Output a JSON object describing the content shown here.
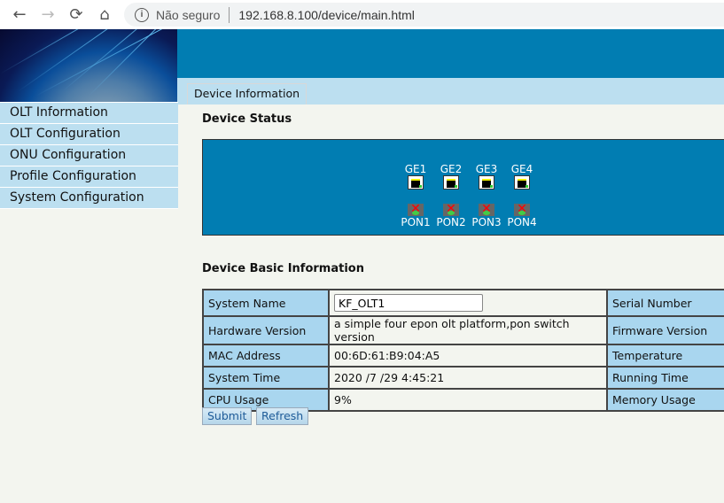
{
  "browser": {
    "back": "←",
    "forward": "→",
    "reload": "⟳",
    "home": "⌂",
    "security": "Não seguro",
    "url": "192.168.8.100/device/main.html"
  },
  "tab": "Device Information",
  "sidebar": [
    "OLT Information",
    "OLT Configuration",
    "ONU Configuration",
    "Profile Configuration",
    "System Configuration"
  ],
  "status": {
    "title": "Device Status",
    "ge": [
      "GE1",
      "GE2",
      "GE3",
      "GE4"
    ],
    "pon": [
      "PON1",
      "PON2",
      "PON3",
      "PON4"
    ]
  },
  "basic": {
    "title": "Device Basic Information",
    "rows": [
      {
        "label": "System Name",
        "value": "KF_OLT1",
        "label2": "Serial Number"
      },
      {
        "label": "Hardware Version",
        "value": "a simple four epon olt platform,pon switch version",
        "label2": "Firmware Version"
      },
      {
        "label": "MAC Address",
        "value": "00:6D:61:B9:04:A5",
        "label2": "Temperature"
      },
      {
        "label": "System Time",
        "value": "2020 /7 /29 4:45:21",
        "label2": "Running Time"
      },
      {
        "label": "CPU Usage",
        "value": "9%",
        "label2": "Memory Usage"
      }
    ]
  },
  "buttons": {
    "submit": "Submit",
    "refresh": "Refresh"
  }
}
